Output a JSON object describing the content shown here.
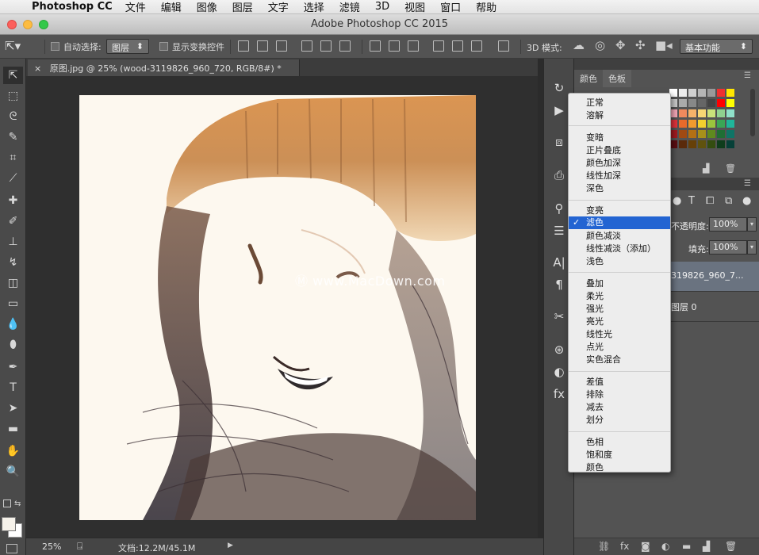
{
  "menubar": {
    "app_name": "Photoshop CC",
    "items": [
      "文件",
      "编辑",
      "图像",
      "图层",
      "文字",
      "选择",
      "滤镜",
      "3D",
      "视图",
      "窗口",
      "帮助"
    ]
  },
  "window": {
    "title": "Adobe Photoshop CC 2015"
  },
  "options_bar": {
    "auto_select_label": "自动选择:",
    "auto_select_value": "图层",
    "show_transform_label": "显示变换控件",
    "mode_3d_label": "3D 模式:",
    "workspace_value": "基本功能"
  },
  "document": {
    "tab_close": "×",
    "tab_label": "原图.jpg @ 25% (wood-3119826_960_720, RGB/8#) *"
  },
  "status_bar": {
    "zoom": "25%",
    "doc_info": "文档:12.2M/45.1M"
  },
  "panels": {
    "tab_color": "颜色",
    "tab_swatches": "色板",
    "opacity_label": "不透明度:",
    "opacity_value": "100%",
    "fill_label": "填充:",
    "fill_value": "100%",
    "layer_top_name": "319826_960_7...",
    "layer_bottom_name": "图层 0"
  },
  "blend_menu": {
    "groups": [
      [
        "正常",
        "溶解"
      ],
      [
        "变暗",
        "正片叠底",
        "颜色加深",
        "线性加深",
        "深色"
      ],
      [
        "变亮",
        "滤色",
        "颜色减淡",
        "线性减淡（添加）",
        "浅色"
      ],
      [
        "叠加",
        "柔光",
        "强光",
        "亮光",
        "线性光",
        "点光",
        "实色混合"
      ],
      [
        "差值",
        "排除",
        "减去",
        "划分"
      ],
      [
        "色相",
        "饱和度",
        "颜色"
      ]
    ],
    "selected": "滤色",
    "checkmark": "✓"
  },
  "watermark": "www.MacDown.com",
  "colors": {
    "accent_select": "#2364d2",
    "panel_bg": "#535353",
    "canvas_bg": "#2f2f2f"
  }
}
